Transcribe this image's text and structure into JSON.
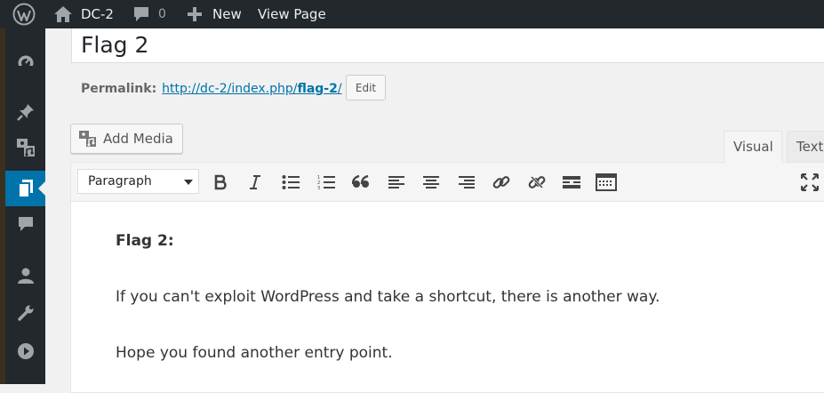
{
  "adminbar": {
    "site_name": "DC-2",
    "comments_count": "0",
    "new_label": "New",
    "view_page_label": "View Page"
  },
  "sidebar": {
    "items": [
      "dashboard-icon",
      "pin-icon",
      "media-icon",
      "pages-icon",
      "comments-icon",
      "users-icon",
      "tools-icon",
      "play-icon"
    ],
    "active": "pages-icon"
  },
  "post": {
    "title": "Flag 2",
    "permalink_label": "Permalink:",
    "permalink_prefix": "http://dc-2/index.php/",
    "permalink_slug": "flag-2",
    "permalink_suffix": "/",
    "edit_label": "Edit"
  },
  "media": {
    "add_media_label": "Add Media"
  },
  "tabs": {
    "visual": "Visual",
    "text": "Text"
  },
  "toolbar": {
    "format_value": "Paragraph",
    "buttons": [
      "bold-icon",
      "italic-icon",
      "bullet-list-icon",
      "numbered-list-icon",
      "blockquote-icon",
      "align-left-icon",
      "align-center-icon",
      "align-right-icon",
      "link-icon",
      "unlink-icon",
      "read-more-icon",
      "toolbar-toggle-icon",
      "fullscreen-icon"
    ]
  },
  "content": {
    "heading": "Flag 2:",
    "paragraph1": "If you can't exploit WordPress and take a shortcut, there is another way.",
    "paragraph2": "Hope you found another entry point."
  },
  "colors": {
    "adminbar": "#23282d",
    "active": "#0073aa",
    "link": "#0073aa"
  }
}
